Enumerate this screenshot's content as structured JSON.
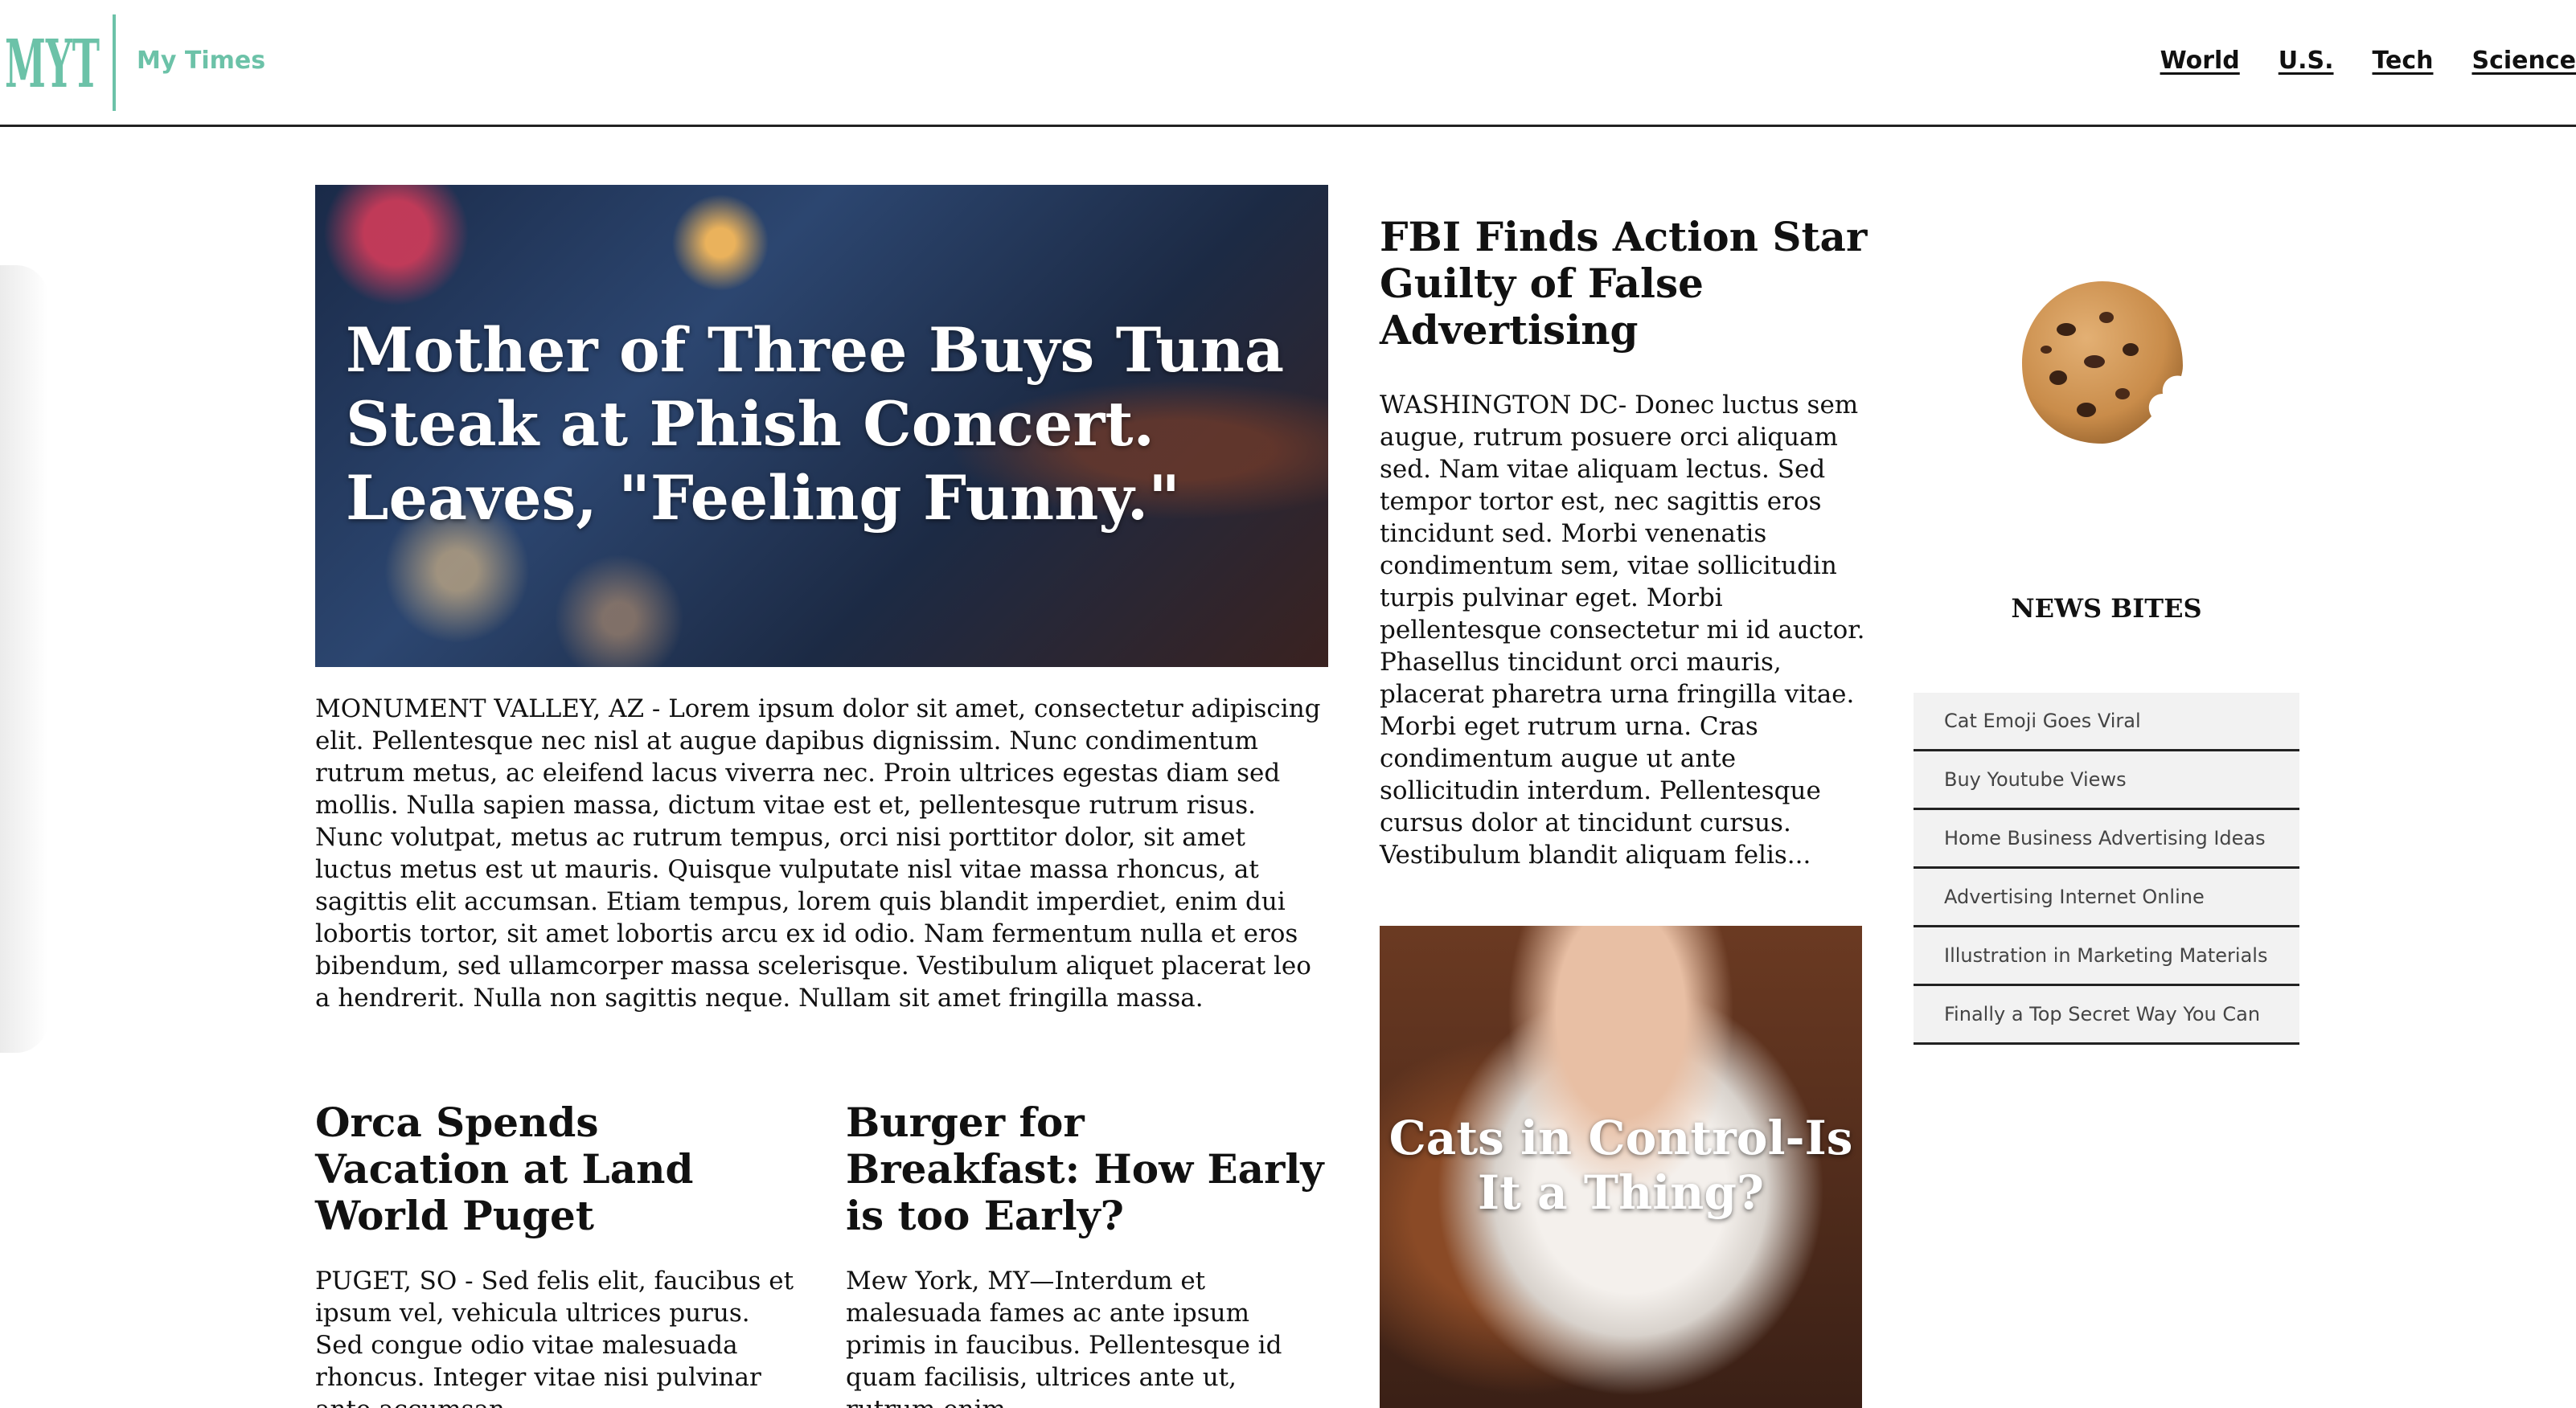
{
  "header": {
    "logo_text": "MYT",
    "brand_name": "My Times",
    "brand_color": "#6cc2a8",
    "nav": [
      "World",
      "U.S.",
      "Tech",
      "Science"
    ]
  },
  "hero": {
    "title": "Mother of Three Buys Tuna Steak at Phish Concert. Leaves, \"Feeling Funny.\"",
    "body": "MONUMENT VALLEY, AZ - Lorem ipsum dolor sit amet, consectetur adipiscing elit. Pellentesque nec nisl at augue dapibus dignissim. Nunc condimentum rutrum metus, ac eleifend lacus viverra nec. Proin ultrices egestas diam sed mollis. Nulla sapien massa, dictum vitae est et, pellentesque rutrum risus. Nunc volutpat, metus ac rutrum tempus, orci nisi porttitor dolor, sit amet luctus metus est ut mauris. Quisque vulputate nisl vitae massa rhoncus, at sagittis elit accumsan. Etiam tempus, lorem quis blandit imperdiet, enim dui lobortis tortor, sit amet lobortis arcu ex id odio. Nam fermentum nulla et eros bibendum, sed ullamcorper massa scelerisque. Vestibulum aliquet placerat leo a hendrerit. Nulla non sagittis neque. Nullam sit amet fringilla massa."
  },
  "orca": {
    "title": "Orca Spends Vacation at Land World Puget",
    "body": "PUGET, SO - Sed felis elit, faucibus et ipsum vel, vehicula ultrices purus. Sed congue odio vitae malesuada rhoncus. Integer vitae nisi pulvinar ante accumsan..."
  },
  "burger": {
    "title": "Burger for Breakfast: How Early is too Early?",
    "body": "Mew York, MY—Interdum et malesuada fames ac ante ipsum primis in faucibus. Pellentesque id quam facilisis, ultrices ante ut, rutrum enim."
  },
  "fbi": {
    "title": "FBI Finds Action Star Guilty of False Advertising",
    "body": "WASHINGTON DC- Donec luctus sem augue, rutrum posuere orci aliquam sed. Nam vitae aliquam lectus. Sed tempor tortor est, nec sagittis eros tincidunt sed. Morbi venenatis condimentum sem, vitae sollicitudin turpis pulvinar eget. Morbi pellentesque consectetur mi id auctor. Phasellus tincidunt orci mauris, placerat pharetra urna fringilla vitae. Morbi eget rutrum urna. Cras condimentum augue ut ante sollicitudin interdum. Pellentesque cursus dolor at tincidunt cursus. Vestibulum blandit aliquam felis..."
  },
  "cats": {
    "title": "Cats in Control-Is It a Thing?"
  },
  "news_bites": {
    "title": "NEWS BITES",
    "items": [
      "Cat Emoji Goes Viral",
      "Buy Youtube Views",
      "Home Business Advertising Ideas",
      "Advertising Internet Online",
      "Illustration in Marketing Materials",
      "Finally a Top Secret Way You Can"
    ]
  }
}
